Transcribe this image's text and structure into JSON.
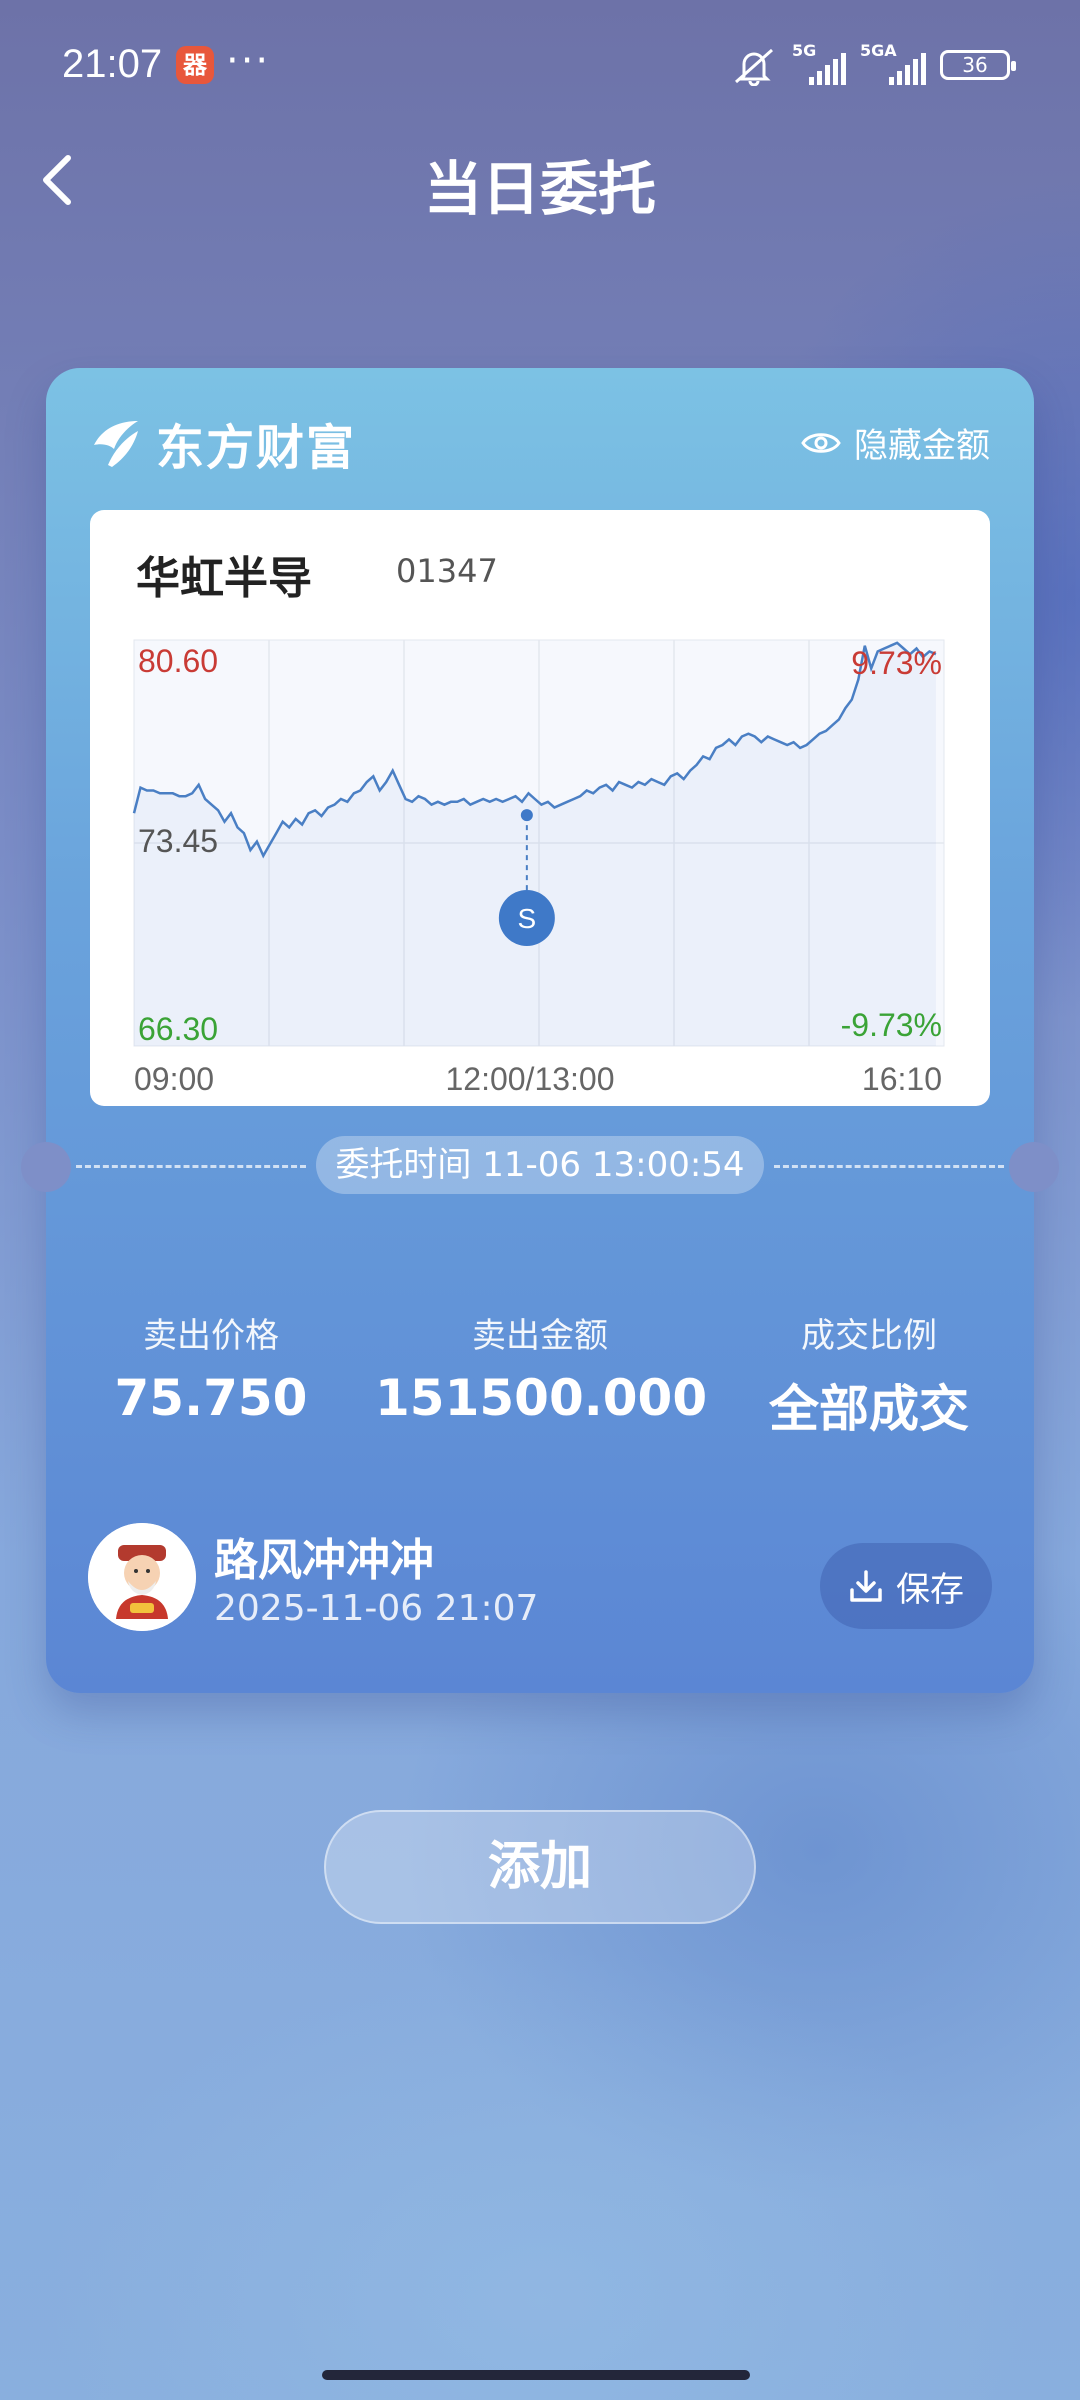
{
  "status_bar": {
    "time": "21:07",
    "app_badge": "器",
    "dots": "···",
    "signal1_label": "5G",
    "signal2_label": "5GA",
    "battery": "36",
    "icons": [
      "mute-bell-icon",
      "signal-5g-icon",
      "signal-5ga-icon",
      "battery-icon"
    ]
  },
  "header": {
    "title": "当日委托",
    "back_icon": "chevron-left-icon"
  },
  "card": {
    "brand_name": "东方财富",
    "hide_amount_label": "隐藏金额",
    "stock": {
      "name": "华虹半导",
      "code": "01347"
    },
    "order_time": "委托时间 11-06 13:00:54",
    "stats": [
      {
        "label": "卖出价格",
        "value": "75.750"
      },
      {
        "label": "卖出金额",
        "value": "151500.000"
      },
      {
        "label": "成交比例",
        "value": "全部成交"
      }
    ],
    "user": {
      "name": "路风冲冲冲",
      "time": "2025-11-06 21:07"
    },
    "save_label": "保存"
  },
  "add_label": "添加",
  "chart_data": {
    "type": "line",
    "y_top": "80.60",
    "y_mid": "73.45",
    "y_bottom": "66.30",
    "pct_top": "9.73%",
    "pct_bottom": "-9.73%",
    "x_labels": [
      "09:00",
      "12:00/13:00",
      "16:10"
    ],
    "ylim": [
      66.3,
      80.6
    ],
    "colors": {
      "line": "#4a7fc4",
      "up": "#c93b35",
      "down": "#3aa336",
      "marker": "#3f79c8"
    },
    "marker": {
      "label": "S",
      "x": 0.485,
      "y": 74.43
    },
    "series": [
      {
        "values": [
          74.5,
          75.4,
          75.3,
          75.3,
          75.2,
          75.2,
          75.2,
          75.1,
          75.1,
          75.2,
          75.5,
          75.0,
          74.8,
          74.6,
          74.2,
          74.5,
          74.0,
          73.8,
          73.2,
          73.5,
          73.0,
          73.4,
          73.8,
          74.2,
          74.0,
          74.3,
          74.1,
          74.5,
          74.6,
          74.4,
          74.7,
          74.8,
          75.0,
          74.9,
          75.2,
          75.3,
          75.6,
          75.8,
          75.3,
          75.6,
          76.0,
          75.5,
          75.0,
          74.9,
          75.1,
          75.0,
          74.8,
          74.9,
          74.8,
          74.9,
          74.9,
          75.0,
          74.8,
          74.9,
          75.0,
          74.9,
          75.0,
          74.9,
          75.0,
          75.1,
          74.9,
          75.2,
          75.0,
          74.8,
          74.9,
          74.7,
          74.8,
          74.9,
          75.0,
          75.1,
          75.3,
          75.2,
          75.4,
          75.5,
          75.3,
          75.6,
          75.5,
          75.4,
          75.6,
          75.5,
          75.7,
          75.6,
          75.5,
          75.8,
          75.9,
          75.7,
          76.0,
          76.2,
          76.5,
          76.4,
          76.8,
          76.9,
          77.1,
          76.9,
          77.2,
          77.3,
          77.2,
          77.0,
          77.2,
          77.1,
          77.0,
          76.9,
          77.0,
          76.8,
          76.9,
          77.1,
          77.3,
          77.4,
          77.6,
          77.8,
          78.2,
          78.5,
          79.2,
          80.4,
          79.6,
          80.2,
          80.3,
          80.4,
          80.5,
          80.3,
          80.1,
          80.3,
          80.0,
          80.2,
          80.1
        ]
      }
    ]
  }
}
